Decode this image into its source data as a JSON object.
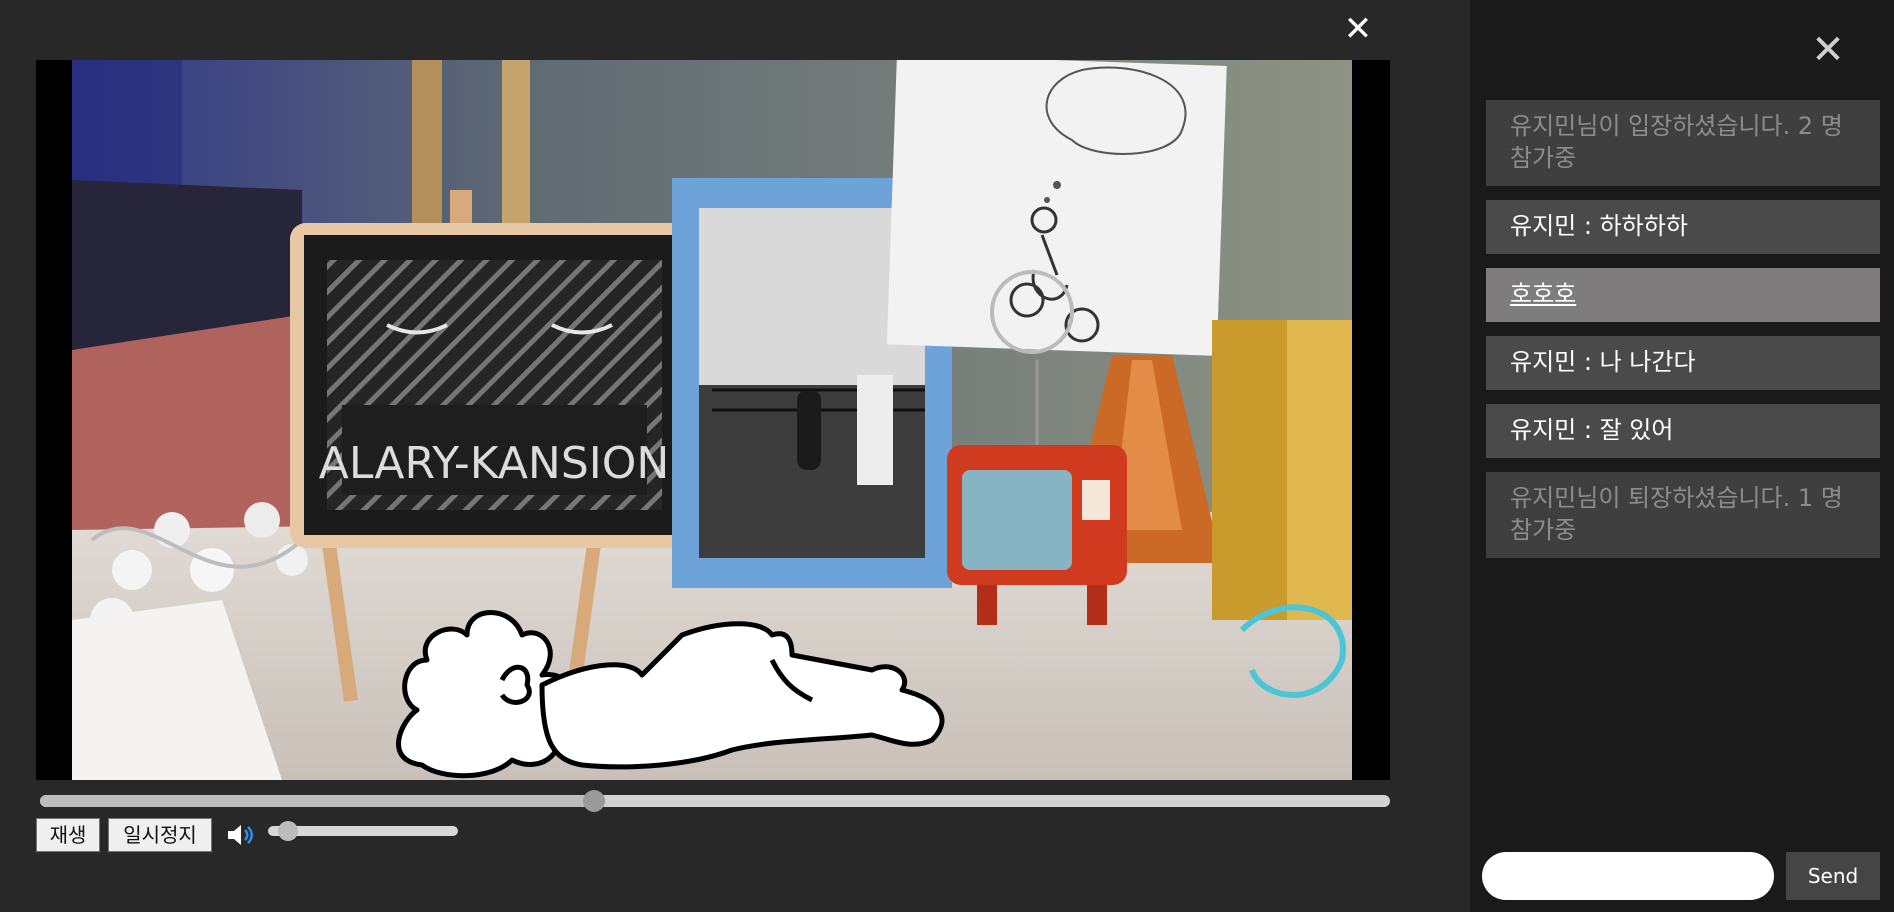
{
  "player": {
    "close_icon": "close-icon",
    "seek_progress": 0.41,
    "volume_level": 0.05,
    "play_label": "재생",
    "pause_label": "일시정지",
    "volume_icon": "speaker-icon",
    "art_text": "ALARY-KANSION"
  },
  "chat": {
    "close_icon": "close-icon",
    "messages": [
      {
        "type": "system",
        "text": "유지민님이 입장하셨습니다. 2 명 참가중"
      },
      {
        "type": "chat",
        "text": "유지민 : 하하하하"
      },
      {
        "type": "highlight",
        "text": "호호호"
      },
      {
        "type": "chat",
        "text": "유지민 : 나 나간다"
      },
      {
        "type": "chat",
        "text": "유지민 : 잘 있어"
      },
      {
        "type": "system",
        "text": "유지민님이 퇴장하셨습니다. 1 명 참가중"
      }
    ],
    "input_value": "",
    "send_label": "Send"
  },
  "colors": {
    "background": "#282828",
    "chat_background": "#1a1a1a",
    "message_bg": "#4a4a4a",
    "system_bg": "#3f3f3f",
    "highlight_bg": "#7e7c7d"
  }
}
